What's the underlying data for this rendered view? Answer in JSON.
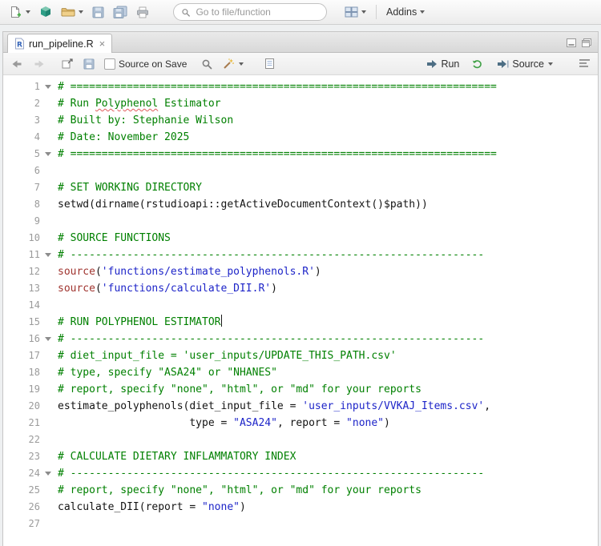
{
  "main_toolbar": {
    "goto_placeholder": "Go to file/function",
    "addins_label": "Addins"
  },
  "tab_bar": {
    "tab_title": "run_pipeline.R",
    "close_glyph": "×"
  },
  "source_toolbar": {
    "source_on_save_label": "Source on Save",
    "run_label": "Run",
    "source_label": "Source"
  },
  "syntax_colors": {
    "comment": "#008000",
    "string": "#1d24c8",
    "keyword": "#a0342f",
    "plain": "#141414",
    "spellcheck_underline": "#e05c5c"
  },
  "editor": {
    "lines": [
      {
        "n": 1,
        "fold": true,
        "tokens": [
          [
            "c",
            "# ===================================================================="
          ]
        ]
      },
      {
        "n": 2,
        "fold": false,
        "tokens": [
          [
            "c",
            "# Run "
          ],
          [
            "c sp",
            "Polyphenol"
          ],
          [
            "c",
            " Estimator"
          ]
        ]
      },
      {
        "n": 3,
        "fold": false,
        "tokens": [
          [
            "c",
            "# Built by: Stephanie Wilson"
          ]
        ]
      },
      {
        "n": 4,
        "fold": false,
        "tokens": [
          [
            "c",
            "# Date: November 2025"
          ]
        ]
      },
      {
        "n": 5,
        "fold": true,
        "tokens": [
          [
            "c",
            "# ===================================================================="
          ]
        ]
      },
      {
        "n": 6,
        "fold": false,
        "tokens": []
      },
      {
        "n": 7,
        "fold": false,
        "tokens": [
          [
            "c",
            "# SET WORKING DIRECTORY"
          ]
        ]
      },
      {
        "n": 8,
        "fold": false,
        "tokens": [
          [
            "p",
            "setwd(dirname(rstudioapi::getActiveDocumentContext()$path))"
          ]
        ]
      },
      {
        "n": 9,
        "fold": false,
        "tokens": []
      },
      {
        "n": 10,
        "fold": false,
        "tokens": [
          [
            "c",
            "# SOURCE FUNCTIONS"
          ]
        ]
      },
      {
        "n": 11,
        "fold": true,
        "tokens": [
          [
            "c",
            "# ------------------------------------------------------------------"
          ]
        ]
      },
      {
        "n": 12,
        "fold": false,
        "tokens": [
          [
            "k",
            "source"
          ],
          [
            "p",
            "("
          ],
          [
            "s",
            "'functions/estimate_polyphenols.R'"
          ],
          [
            "p",
            ")"
          ]
        ]
      },
      {
        "n": 13,
        "fold": false,
        "tokens": [
          [
            "k",
            "source"
          ],
          [
            "p",
            "("
          ],
          [
            "s",
            "'functions/calculate_DII.R'"
          ],
          [
            "p",
            ")"
          ]
        ]
      },
      {
        "n": 14,
        "fold": false,
        "tokens": []
      },
      {
        "n": 15,
        "fold": false,
        "tokens": [
          [
            "c",
            "# RUN POLYPHENOL ESTIMATOR"
          ],
          [
            "cur",
            ""
          ]
        ]
      },
      {
        "n": 16,
        "fold": true,
        "tokens": [
          [
            "c",
            "# ------------------------------------------------------------------"
          ]
        ]
      },
      {
        "n": 17,
        "fold": false,
        "tokens": [
          [
            "c",
            "# diet_input_file = 'user_inputs/UPDATE_THIS_PATH.csv'"
          ]
        ]
      },
      {
        "n": 18,
        "fold": false,
        "tokens": [
          [
            "c",
            "# type, specify \"ASA24\" or \"NHANES\""
          ]
        ]
      },
      {
        "n": 19,
        "fold": false,
        "tokens": [
          [
            "c",
            "# report, specify \"none\", \"html\", or \"md\" for your reports"
          ]
        ]
      },
      {
        "n": 20,
        "fold": false,
        "tokens": [
          [
            "p",
            "estimate_polyphenols(diet_input_file = "
          ],
          [
            "s",
            "'user_inputs/VVKAJ_Items.csv'"
          ],
          [
            "p",
            ","
          ]
        ]
      },
      {
        "n": 21,
        "fold": false,
        "tokens": [
          [
            "p",
            "                     type = "
          ],
          [
            "s",
            "\"ASA24\""
          ],
          [
            "p",
            ", report = "
          ],
          [
            "s",
            "\"none\""
          ],
          [
            "p",
            ")"
          ]
        ]
      },
      {
        "n": 22,
        "fold": false,
        "tokens": []
      },
      {
        "n": 23,
        "fold": false,
        "tokens": [
          [
            "c",
            "# CALCULATE DIETARY INFLAMMATORY INDEX"
          ]
        ]
      },
      {
        "n": 24,
        "fold": true,
        "tokens": [
          [
            "c",
            "# ------------------------------------------------------------------"
          ]
        ]
      },
      {
        "n": 25,
        "fold": false,
        "tokens": [
          [
            "c",
            "# report, specify \"none\", \"html\", or \"md\" for your reports"
          ]
        ]
      },
      {
        "n": 26,
        "fold": false,
        "tokens": [
          [
            "p",
            "calculate_DII(report = "
          ],
          [
            "s",
            "\"none\""
          ],
          [
            "p",
            ")"
          ]
        ]
      },
      {
        "n": 27,
        "fold": false,
        "tokens": []
      }
    ]
  }
}
